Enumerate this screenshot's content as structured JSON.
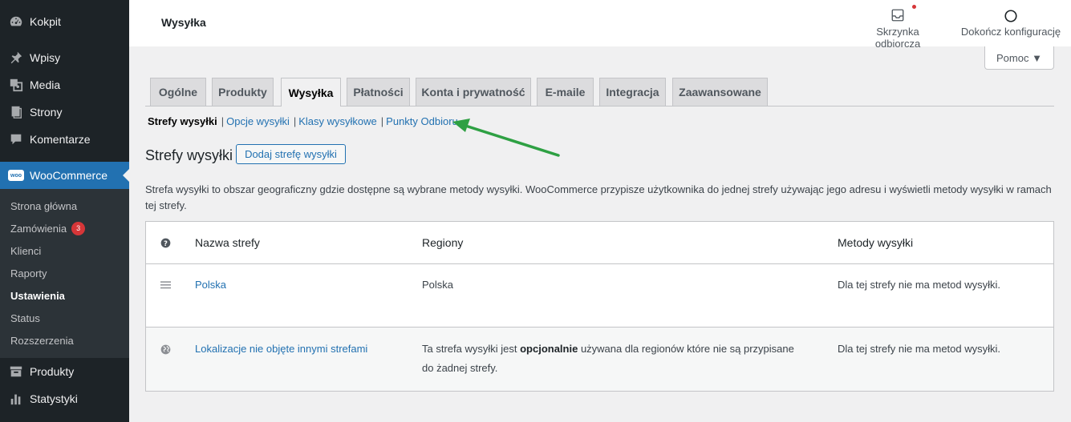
{
  "sidebar": {
    "items_top": [
      {
        "label": "Kokpit",
        "icon": "dashboard-icon"
      },
      {
        "label": "Wpisy",
        "icon": "pin-icon"
      },
      {
        "label": "Media",
        "icon": "media-icon"
      },
      {
        "label": "Strony",
        "icon": "page-icon"
      },
      {
        "label": "Komentarze",
        "icon": "comment-icon"
      }
    ],
    "woocommerce": {
      "label": "WooCommerce",
      "logo_text": "woo"
    },
    "submenu": [
      {
        "label": "Strona główna"
      },
      {
        "label": "Zamówienia",
        "badge": "3"
      },
      {
        "label": "Klienci"
      },
      {
        "label": "Raporty"
      },
      {
        "label": "Ustawienia"
      },
      {
        "label": "Status"
      },
      {
        "label": "Rozszerzenia"
      }
    ],
    "items_bottom": [
      {
        "label": "Produkty",
        "icon": "archive-icon"
      },
      {
        "label": "Statystyki",
        "icon": "bar-chart-icon"
      }
    ]
  },
  "header": {
    "title": "Wysyłka",
    "inbox_label": "Skrzynka odbiorcza",
    "setup_label": "Dokończ konfigurację",
    "help_label": "Pomoc ▼"
  },
  "tabs": [
    "Ogólne",
    "Produkty",
    "Wysyłka",
    "Płatności",
    "Konta i prywatność",
    "E-maile",
    "Integracja",
    "Zaawansowane"
  ],
  "active_tab": "Wysyłka",
  "subnav": {
    "current": "Strefy wysyłki",
    "links": [
      "Opcje wysyłki",
      "Klasy wysyłkowe",
      "Punkty Odbioru"
    ]
  },
  "section": {
    "title": "Strefy wysyłki",
    "add_button": "Dodaj strefę wysyłki",
    "description": "Strefa wysyłki to obszar geograficzny gdzie dostępne są wybrane metody wysyłki. WooCommerce przypisze użytkownika do jednej strefy używając jego adresu i wyświetli metody wysyłki w ramach tej strefy."
  },
  "table": {
    "headers": {
      "name": "Nazwa strefy",
      "regions": "Regiony",
      "methods": "Metody wysyłki"
    },
    "rows": [
      {
        "name": "Polska",
        "regions": "Polska",
        "methods": "Dla tej strefy nie ma metod wysyłki."
      },
      {
        "name": "Lokalizacje nie objęte innymi strefami",
        "regions_pre": "Ta strefa wysyłki jest ",
        "regions_bold": "opcjonalnie",
        "regions_post": " używana dla regionów które nie są przypisane do żadnej strefy.",
        "methods": "Dla tej strefy nie ma metod wysyłki."
      }
    ]
  },
  "colors": {
    "accent": "#2271b1",
    "sidebar": "#1d2327",
    "arrow": "#2ea043",
    "badge": "#d63638"
  }
}
